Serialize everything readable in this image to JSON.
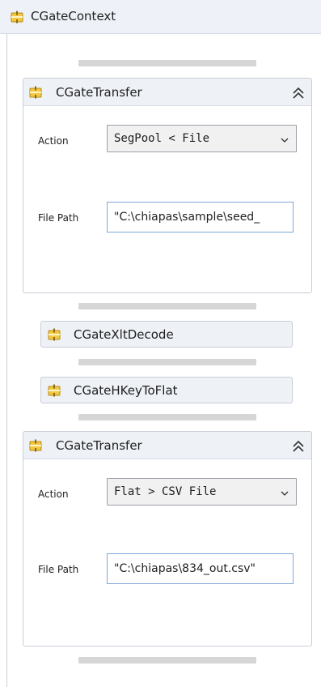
{
  "root": {
    "title": "CGateContext",
    "icon": "activity-icon"
  },
  "transfer_1": {
    "title": "CGateTransfer",
    "icon": "activity-icon",
    "collapse_icon": "double-chevron-up-icon",
    "action_label": "Action",
    "action_value": "SegPool < File",
    "file_path_label": "File Path",
    "file_path_value": "\"C:\\chiapas\\sample\\seed_"
  },
  "xlt_decode": {
    "title": "CGateXltDecode",
    "icon": "activity-icon"
  },
  "hkey_to_flat": {
    "title": "CGateHKeyToFlat",
    "icon": "activity-icon"
  },
  "transfer_2": {
    "title": "CGateTransfer",
    "icon": "activity-icon",
    "collapse_icon": "double-chevron-up-icon",
    "action_label": "Action",
    "action_value": "Flat > CSV File",
    "file_path_label": "File Path",
    "file_path_value": "\"C:\\chiapas\\834_out.csv\""
  },
  "colors": {
    "header_bg": "#eef2f8",
    "drop_zone": "#d6d6d6",
    "field_border": "#7fa7d8",
    "icon_gold": "#e8b830"
  }
}
